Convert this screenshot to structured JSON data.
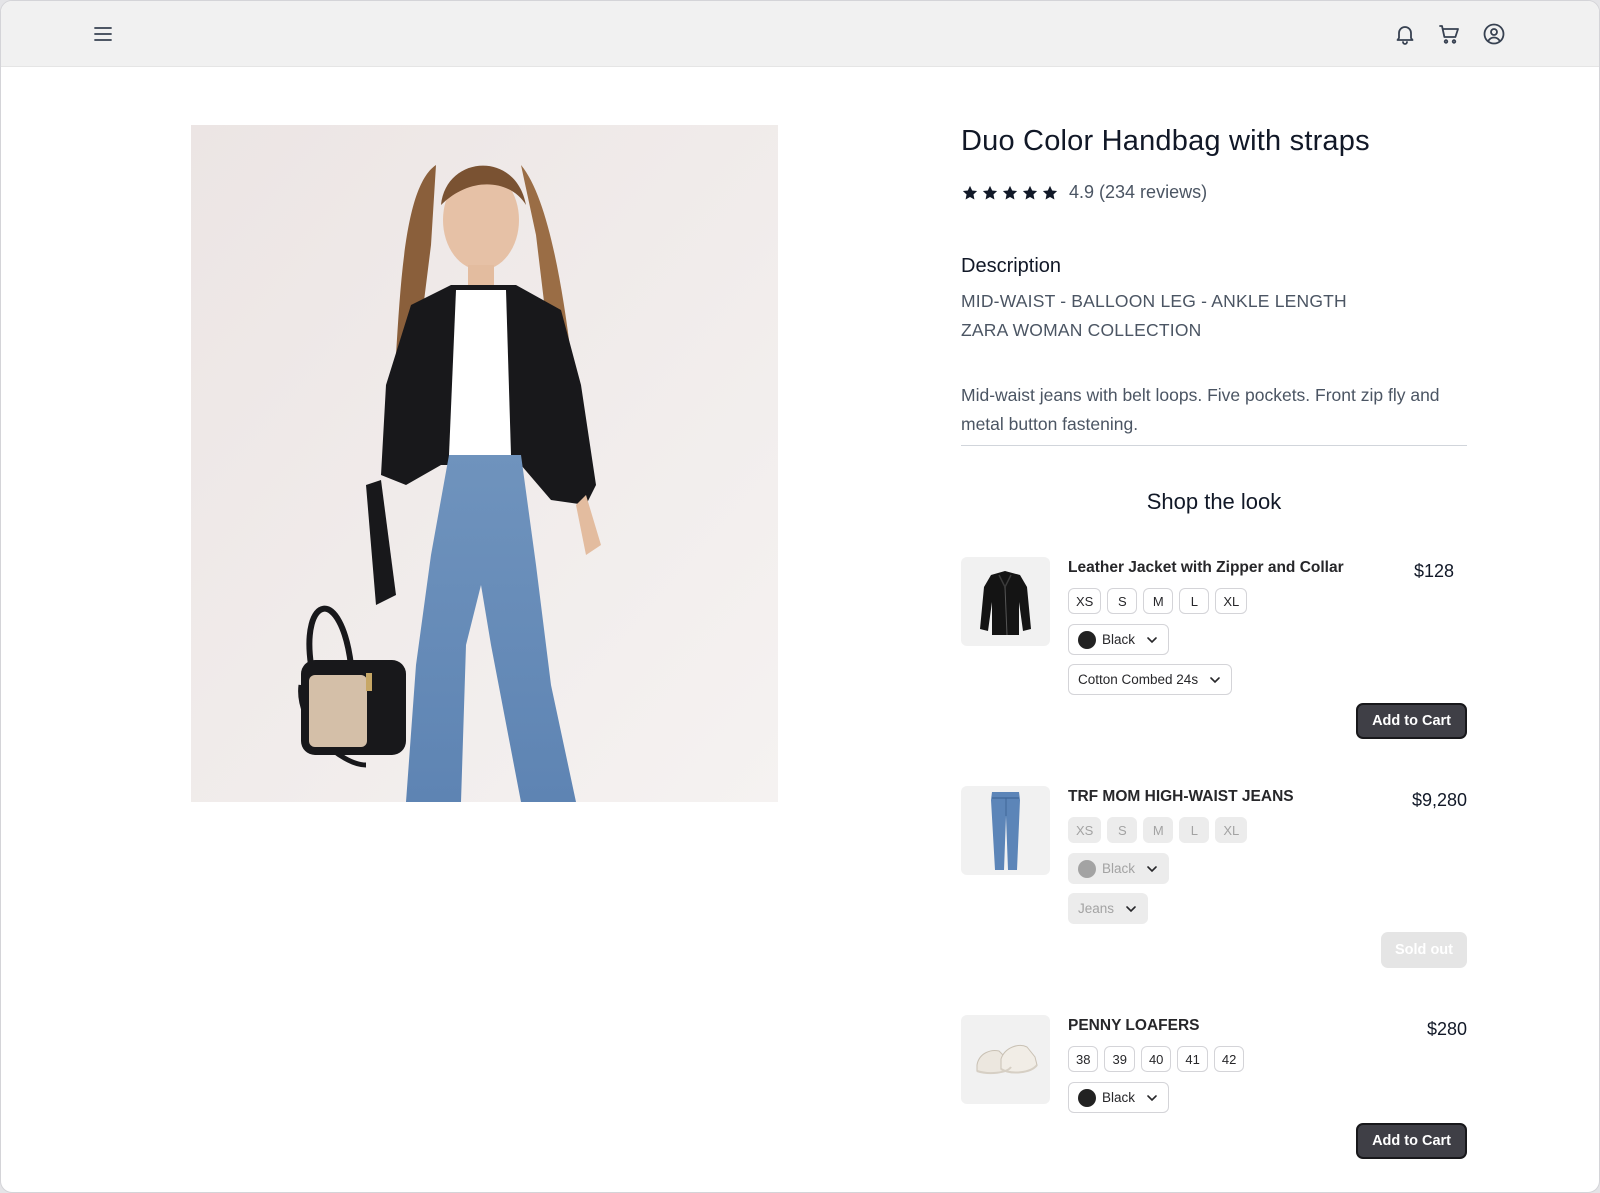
{
  "topbar": {
    "menu_icon": "menu-icon",
    "notification_icon": "bell-icon",
    "cart_icon": "cart-icon",
    "account_icon": "user-circle-icon"
  },
  "product": {
    "title": "Duo Color Handbag with straps",
    "rating": 5,
    "rating_value": "4.9",
    "reviews": "(234 reviews)",
    "description_label": "Description",
    "description_line1": "MID-WAIST - BALLOON LEG - ANKLE LENGTH",
    "description_line2": "ZARA WOMAN COLLECTION",
    "description_body": "Mid-waist jeans with belt loops. Five pockets. Front zip fly and metal button fastening."
  },
  "shop_the_look": {
    "title": "Shop the look",
    "items": [
      {
        "name": "Leather Jacket with Zipper and Collar",
        "price": "$128",
        "sizes": [
          "XS",
          "S",
          "M",
          "L",
          "XL"
        ],
        "color": "Black",
        "fabric": "Cotton Combed 24s",
        "action": "Add to Cart",
        "available": true
      },
      {
        "name": "TRF MOM HIGH-WAIST JEANS",
        "price": "$9,280",
        "sizes": [
          "XS",
          "S",
          "M",
          "L",
          "XL"
        ],
        "color": "Black",
        "fabric": "Jeans",
        "action": "Sold out",
        "available": false
      },
      {
        "name": "PENNY LOAFERS",
        "price": "$280",
        "sizes": [
          "38",
          "39",
          "40",
          "41",
          "42"
        ],
        "color": "Black",
        "action": "Add to Cart",
        "available": true
      }
    ]
  },
  "colors": {
    "accent_dark": "#3f3f46",
    "star": "#111827",
    "disabled": "#e5e5e5"
  }
}
